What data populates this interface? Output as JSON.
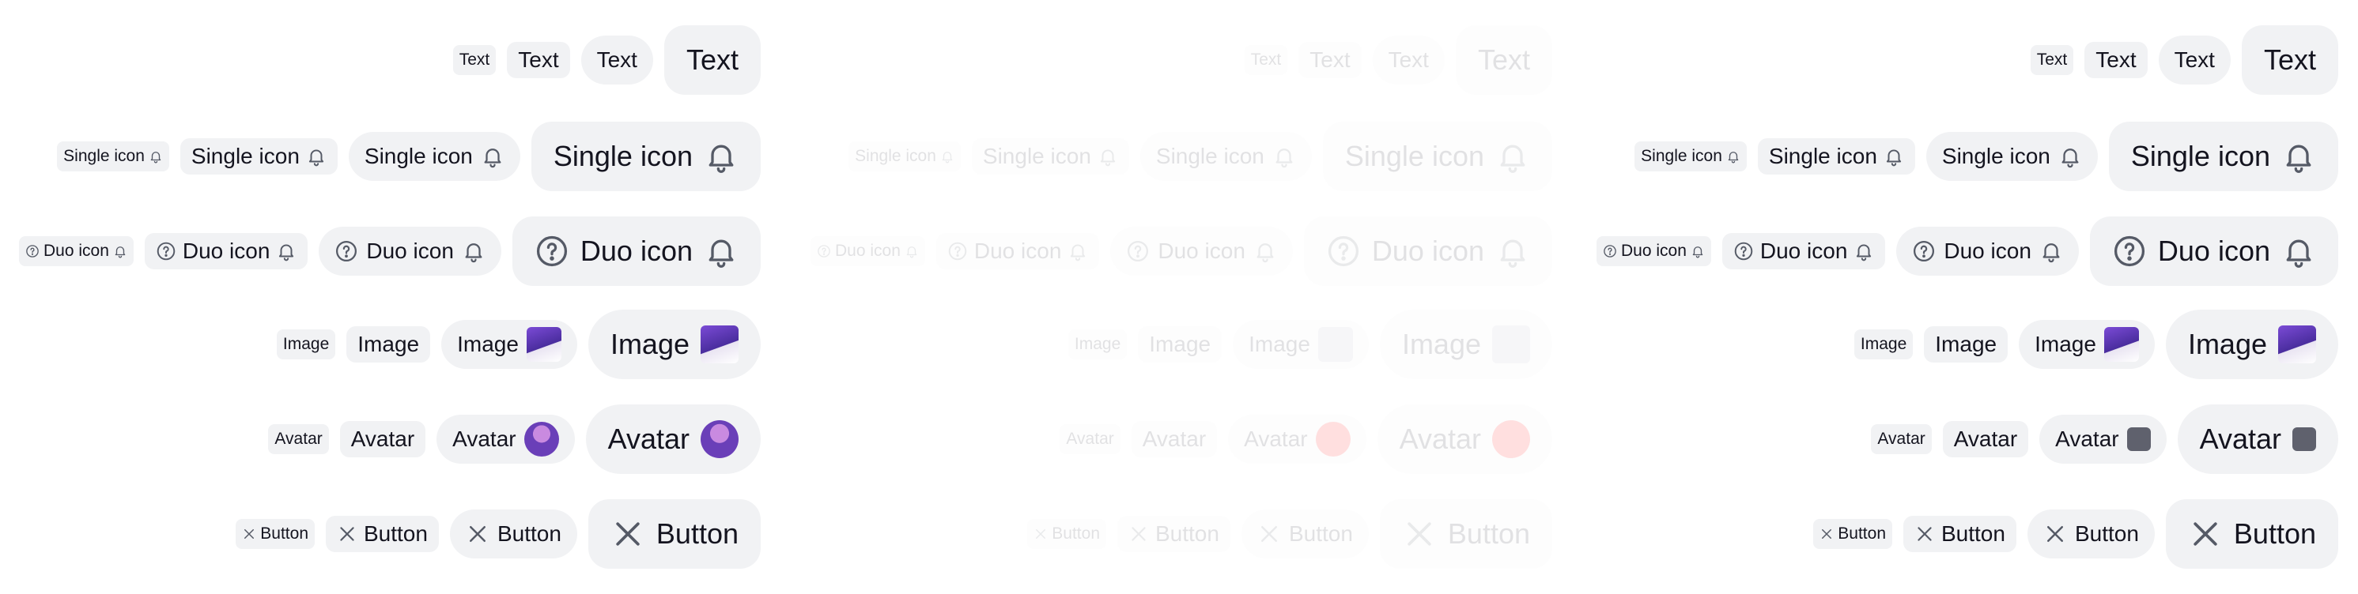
{
  "labels": {
    "text": "Text",
    "single_icon": "Single icon",
    "duo_icon": "Duo icon",
    "image": "Image",
    "avatar": "Avatar",
    "button": "Button"
  },
  "icons": {
    "bell": "bell-icon",
    "help": "help-circle-icon",
    "close": "close-icon",
    "image": "image-thumbnail",
    "avatar": "avatar"
  },
  "panels": [
    {
      "name": "default",
      "state": "default"
    },
    {
      "name": "disabled",
      "state": "disabled"
    },
    {
      "name": "alternate",
      "state": "default"
    }
  ],
  "colors": {
    "chip_bg": "#f1f2f4",
    "text": "#14141f",
    "icon": "#555a66",
    "disabled_avatar": "#ff0000",
    "thumb_purple": "#7b4bd6"
  }
}
